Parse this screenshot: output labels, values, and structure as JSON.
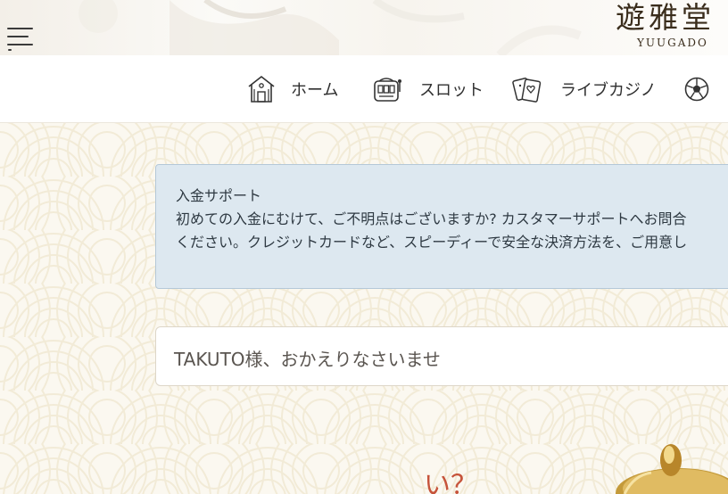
{
  "header": {
    "brand_kanji": "遊雅堂",
    "brand_roman": "YUUGADO",
    "menu_icon": "hamburger-menu-icon"
  },
  "nav": {
    "items": [
      {
        "label": "ホーム",
        "icon": "home-icon"
      },
      {
        "label": "スロット",
        "icon": "slot-machine-icon"
      },
      {
        "label": "ライブカジノ",
        "icon": "playing-cards-icon"
      },
      {
        "label": "",
        "icon": "soccer-ball-icon"
      }
    ]
  },
  "notice": {
    "title": "入金サポート",
    "line1": "初めての入金にむけて、ご不明点はございますか? カスタマーサポートへお問合",
    "line2": "ください。クレジットカードなど、スピーディーで安全な決済方法を、ご用意し"
  },
  "welcome": {
    "message": "TAKUTO様、おかえりなさいませ"
  },
  "decor": {
    "partial_text": "い？"
  },
  "colors": {
    "notice_bg": "#dde8f0",
    "notice_border": "#b4c8d8",
    "page_bg": "#fbf8f0",
    "accent_red": "#c6533a"
  }
}
